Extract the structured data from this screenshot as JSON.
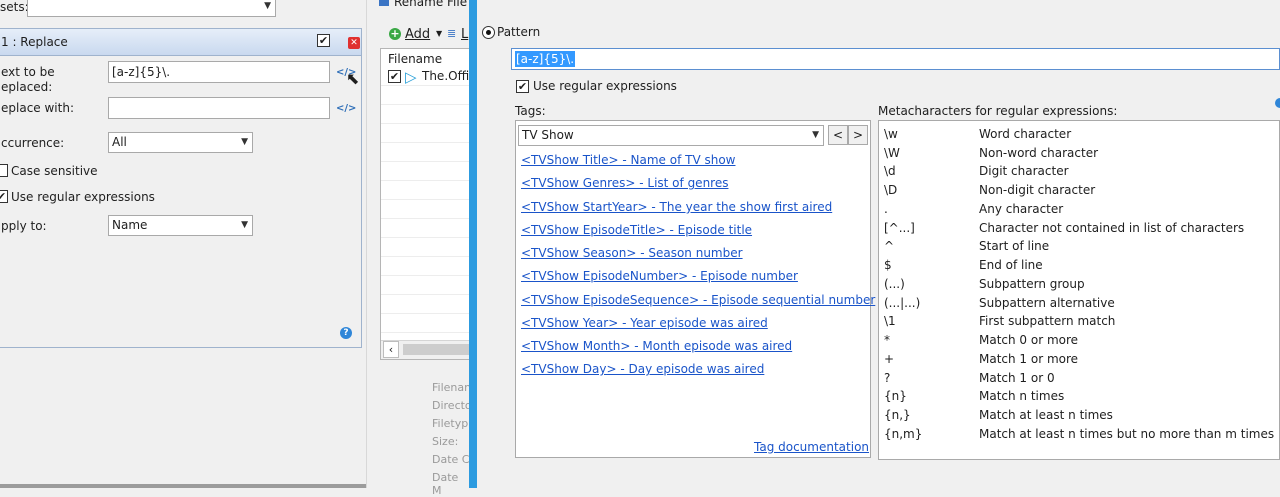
{
  "left": {
    "presets_label": "sets:",
    "rule_title": "1 : Replace",
    "text_to_be_replaced_label_1": "ext to be",
    "text_to_be_replaced_label_2": "eplaced:",
    "text_to_be_replaced_value": "[a-z]{5}\\.",
    "replace_with_label": "eplace with:",
    "replace_with_value": "",
    "occurrence_label": "ccurrence:",
    "occurrence_value": "All",
    "case_sensitive_label": "Case sensitive",
    "use_regex_label": "Use regular expressions",
    "apply_to_label": "pply to:",
    "apply_to_value": "Name",
    "insert_tag_icon": "</>",
    "help_icon": "?"
  },
  "middle": {
    "title": "Rename File",
    "add_label": "Add",
    "list_label": "L",
    "filename_header": "Filename",
    "file_row": "The.Offic",
    "props": [
      "Filenam",
      "Directo",
      "Filetyp",
      "Size:",
      "Date C",
      "Date M"
    ]
  },
  "right": {
    "pattern_label": "Pattern",
    "pattern_value": "[a-z]{5}\\.",
    "use_regex_label": "Use regular expressions",
    "tags_label": "Tags:",
    "tags_category": "TV Show",
    "prev_label": "<",
    "next_label": ">",
    "tags": [
      "<TVShow Title> - Name of TV show",
      "<TVShow Genres> - List of genres",
      "<TVShow StartYear> - The year the show first aired",
      "<TVShow EpisodeTitle> - Episode title",
      "<TVShow Season> - Season number",
      "<TVShow EpisodeNumber> - Episode number",
      "<TVShow EpisodeSequence> - Episode sequential number",
      "<TVShow Year> - Year episode was aired",
      "<TVShow Month> - Month episode was aired",
      "<TVShow Day> - Day episode was aired"
    ],
    "tag_doc_label": "Tag documentation",
    "meta_label": "Metacharacters for regular expressions:",
    "meta": [
      {
        "sym": "\\w",
        "desc": "Word character"
      },
      {
        "sym": "\\W",
        "desc": "Non-word character"
      },
      {
        "sym": "\\d",
        "desc": "Digit character"
      },
      {
        "sym": "\\D",
        "desc": "Non-digit character"
      },
      {
        "sym": ".",
        "desc": "Any character"
      },
      {
        "sym": "[^...]",
        "desc": "Character not contained in list of characters"
      },
      {
        "sym": "^",
        "desc": "Start of line"
      },
      {
        "sym": "$",
        "desc": "End of line"
      },
      {
        "sym": "(...)",
        "desc": "Subpattern group"
      },
      {
        "sym": "(...|...)",
        "desc": "Subpattern alternative"
      },
      {
        "sym": "\\1",
        "desc": "First subpattern match"
      },
      {
        "sym": "*",
        "desc": "Match 0 or more"
      },
      {
        "sym": "+",
        "desc": "Match 1 or more"
      },
      {
        "sym": "?",
        "desc": "Match 1 or 0"
      },
      {
        "sym": "{n}",
        "desc": "Match n times"
      },
      {
        "sym": "{n,}",
        "desc": "Match at least n times"
      },
      {
        "sym": "{n,m}",
        "desc": "Match at least n times but no more than m times"
      }
    ]
  }
}
